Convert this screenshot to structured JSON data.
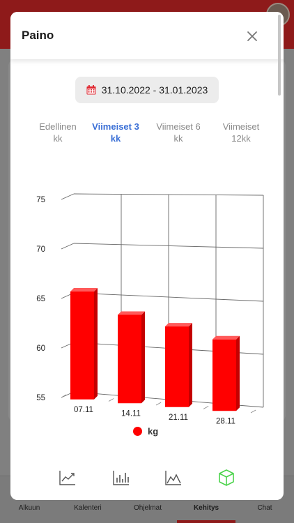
{
  "colors": {
    "accent": "#3a6fd6",
    "bar": "#ff0000",
    "active_chart_type": "#4cd34c"
  },
  "background_tabbar": [
    "Alkuun",
    "Kalenteri",
    "Ohjelmat",
    "Kehitys",
    "Chat"
  ],
  "modal": {
    "title": "Paino",
    "date_range": "31.10.2022 - 31.01.2023",
    "range_tabs": [
      {
        "line1": "Edellinen",
        "line2": "kk",
        "active": false
      },
      {
        "line1": "Viimeiset 3",
        "line2": "kk",
        "active": true
      },
      {
        "line1": "Viimeiset 6",
        "line2": "kk",
        "active": false
      },
      {
        "line1": "Viimeiset",
        "line2": "12kk",
        "active": false
      }
    ],
    "legend_label": "kg",
    "chart_types": [
      "trend-line-icon",
      "bar-chart-icon",
      "area-chart-icon",
      "cube-3d-icon"
    ],
    "active_chart_type": "cube-3d-icon"
  },
  "chart_data": {
    "type": "bar",
    "categories": [
      "07.11",
      "14.11",
      "21.11",
      "28.11"
    ],
    "series": [
      {
        "name": "kg",
        "values": [
          65.8,
          63.7,
          62.8,
          61.8
        ]
      }
    ],
    "ylim": [
      55,
      75
    ],
    "yticks": [
      75,
      70,
      65,
      60,
      55
    ],
    "grid": true,
    "legend": "bottom",
    "style": "3d"
  }
}
